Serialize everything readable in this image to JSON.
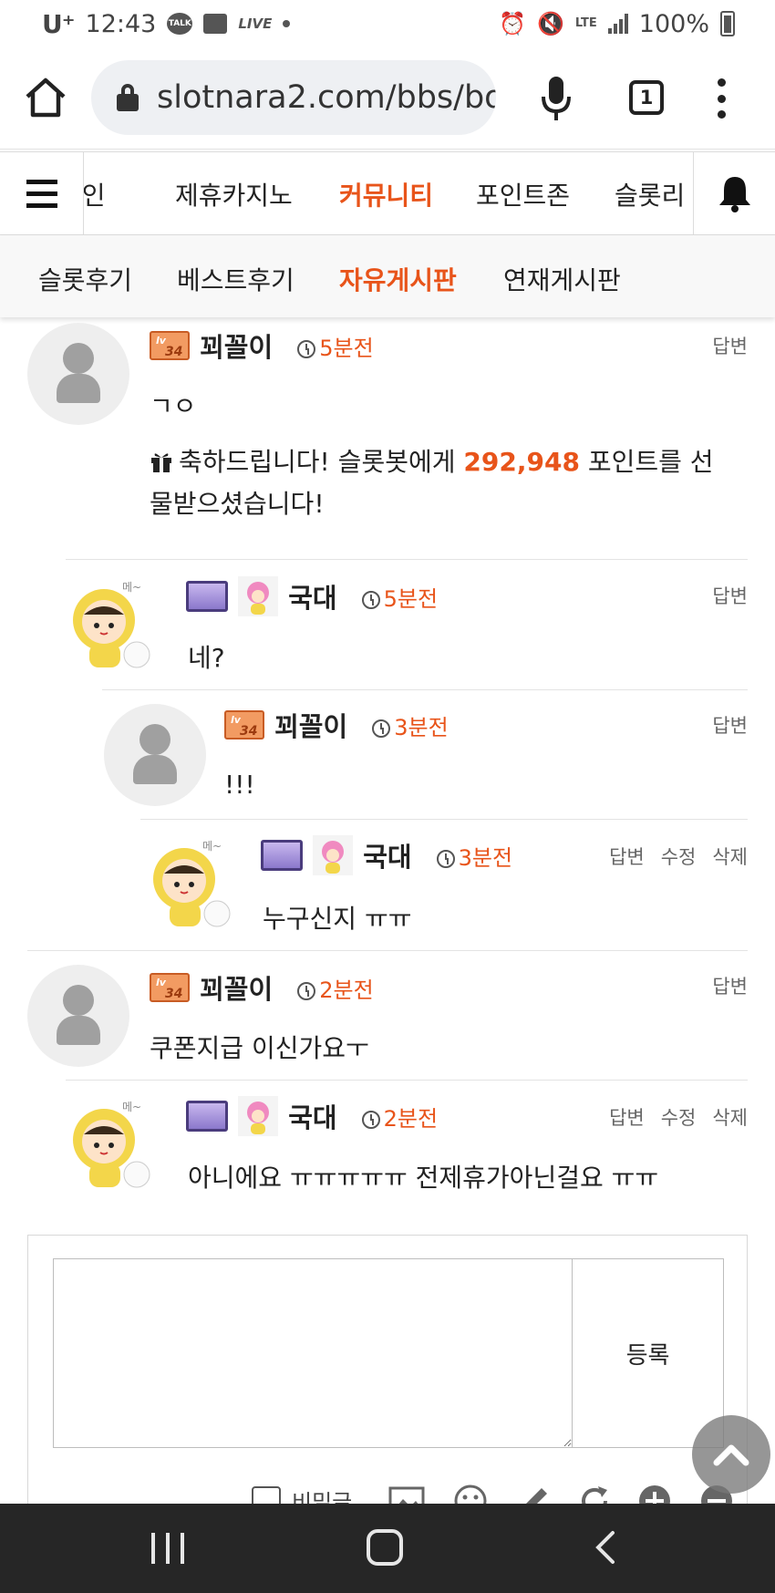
{
  "status_bar": {
    "carrier": "U⁺",
    "time": "12:43",
    "talk_label": "TALK",
    "live_label": "LIVE",
    "lte_label": "LTE",
    "battery": "100%"
  },
  "browser": {
    "url": "slotnara2.com/bbs/bo",
    "tab_count": "1"
  },
  "main_nav": {
    "items": [
      "메인",
      "제휴카지노",
      "커뮤니티",
      "포인트존",
      "슬롯리"
    ],
    "active": "커뮤니티"
  },
  "sub_nav": {
    "items": [
      "슬롯후기",
      "베스트후기",
      "자유게시판",
      "연재게시판"
    ],
    "active": "자유게시판"
  },
  "comments": [
    {
      "author": "꾀꼴이",
      "level": "34",
      "time": "5분전",
      "body": "ㄱㅇ",
      "gift_prefix": "축하드립니다! 슬롯봇에게",
      "gift_points": "292,948",
      "gift_suffix": "포인트를 선",
      "gift_line2": "물받으셨습니다!",
      "actions": [
        "답변"
      ]
    },
    {
      "author": "국대",
      "time": "5분전",
      "body": "네?",
      "actions": [
        "답변"
      ]
    },
    {
      "author": "꾀꼴이",
      "level": "34",
      "time": "3분전",
      "body": "!!!",
      "actions": [
        "답변"
      ]
    },
    {
      "author": "국대",
      "time": "3분전",
      "body": "누구신지 ㅠㅠ",
      "actions": [
        "답변",
        "수정",
        "삭제"
      ]
    },
    {
      "author": "꾀꼴이",
      "level": "34",
      "time": "2분전",
      "body": "쿠폰지급 이신가요ㅜ",
      "actions": [
        "답변"
      ]
    },
    {
      "author": "국대",
      "time": "2분전",
      "body": "아니에요 ㅠㅠㅠㅠㅠ 전제휴가아닌걸요 ㅠㅠ",
      "actions": [
        "답변",
        "수정",
        "삭제"
      ]
    }
  ],
  "editor": {
    "submit_label": "등록",
    "secret_label": "비밀글"
  },
  "colors": {
    "accent": "#e8541a",
    "navbar": "#262626"
  }
}
